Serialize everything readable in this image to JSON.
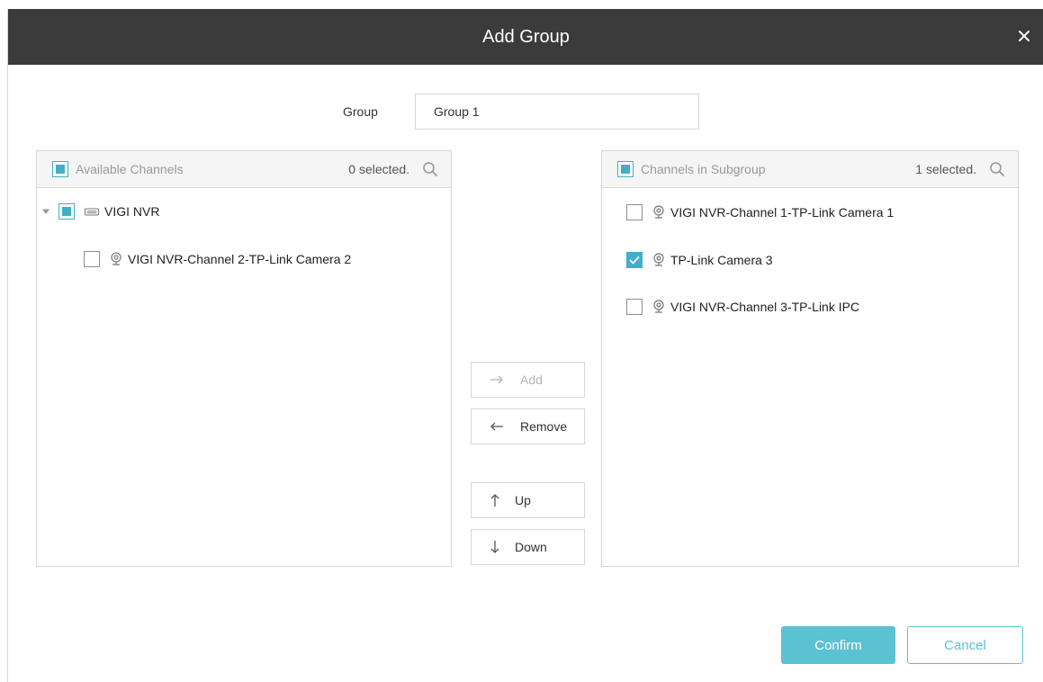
{
  "dialog": {
    "title": "Add Group",
    "close_icon": "close-icon"
  },
  "group": {
    "label": "Group",
    "value": "Group 1"
  },
  "available": {
    "title": "Available Channels",
    "count": "0 selected.",
    "tree": {
      "node_label": "VIGI NVR",
      "node_icon": "nvr-icon",
      "children": [
        {
          "label": "VIGI NVR-Channel  2-TP-Link Camera 2",
          "checked": false,
          "icon": "camera-icon"
        }
      ]
    }
  },
  "subgroup": {
    "title": "Channels in Subgroup",
    "count": "1 selected.",
    "items": [
      {
        "label": "VIGI NVR-Channel  1-TP-Link Camera 1",
        "checked": false,
        "icon": "camera-icon"
      },
      {
        "label": "TP-Link Camera 3",
        "checked": true,
        "icon": "camera-icon"
      },
      {
        "label": "VIGI NVR-Channel  3-TP-Link IPC",
        "checked": false,
        "icon": "camera-icon"
      }
    ]
  },
  "actions": {
    "add": "Add",
    "remove": "Remove",
    "up": "Up",
    "down": "Down"
  },
  "footer": {
    "confirm": "Confirm",
    "cancel": "Cancel"
  },
  "colors": {
    "accent": "#5bc2d3",
    "checkbox_accent": "#3fb0c6",
    "titlebar": "#3b3b3b"
  }
}
